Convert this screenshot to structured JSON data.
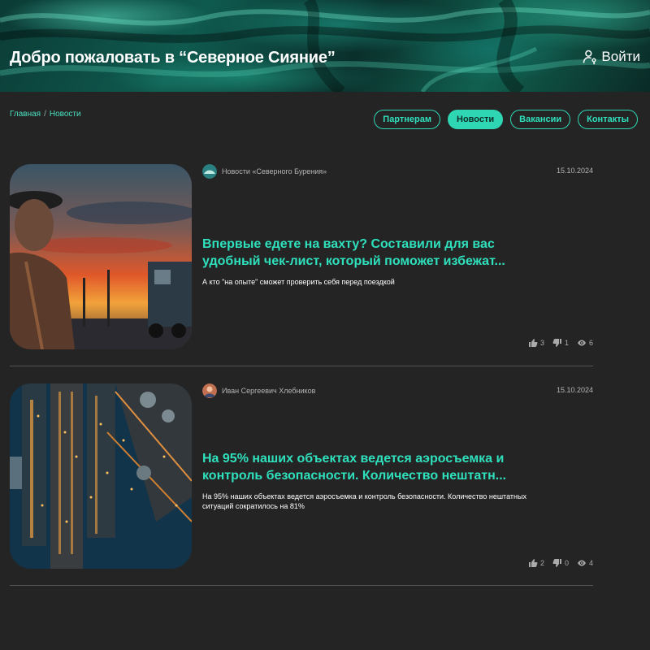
{
  "header": {
    "title": "Добро пожаловать в “Северное Сияние”",
    "login_label": "Войти"
  },
  "breadcrumb": {
    "home": "Главная",
    "separator": "/",
    "current": "Новости"
  },
  "nav": {
    "items": [
      {
        "label": "Партнерам",
        "active": false
      },
      {
        "label": "Новости",
        "active": true
      },
      {
        "label": "Вакансии",
        "active": false
      },
      {
        "label": "Контакты",
        "active": false
      }
    ]
  },
  "posts": [
    {
      "author": "Новости «Северного Бурения»",
      "date": "15.10.2024",
      "title": "Впервые едете на вахту? Составили для вас удобный чек-лист, который поможет избежат...",
      "excerpt": "А кто \"на опыте\" сможет проверить себя перед поездкой",
      "likes": "3",
      "dislikes": "1",
      "views": "6"
    },
    {
      "author": "Иван Сергеевич Хлебников",
      "date": "15.10.2024",
      "title": "На 95% наших объектах ведется аэросъемка и контроль безопасности. Количество нештатн...",
      "excerpt": "На 95% наших объектах ведется аэросъемка и контроль безопасности. Количество нештатных ситуаций сократилось на 81%",
      "likes": "2",
      "dislikes": "0",
      "views": "4"
    }
  ],
  "colors": {
    "accent": "#2fd6b3",
    "background": "#242424"
  }
}
